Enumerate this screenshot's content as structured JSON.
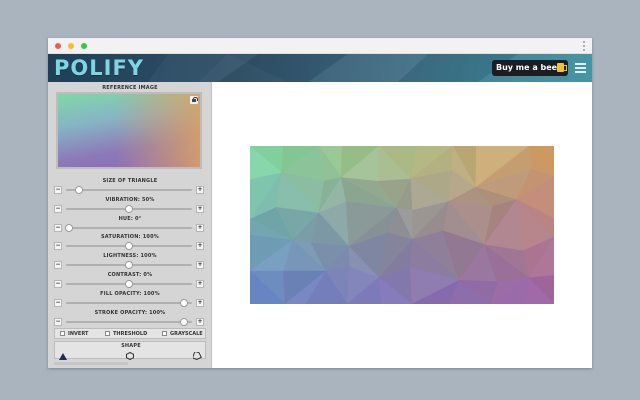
{
  "app": {
    "logo": "POLIFY",
    "buy_button": "Buy me a beer"
  },
  "icons": {
    "lock": "lock-icon",
    "menu": "hamburger-menu-icon",
    "beer": "beer-mug-icon",
    "more": "more-vertical-icon"
  },
  "sidebar": {
    "reference_label": "REFERENCE IMAGE",
    "sliders": [
      {
        "label": "SIZE OF TRIANGLE",
        "value": 0.1
      },
      {
        "label": "VIBRATION: 50%",
        "value": 0.5
      },
      {
        "label": "HUE: 0°",
        "value": 0.02
      },
      {
        "label": "SATURATION: 100%",
        "value": 0.5
      },
      {
        "label": "LIGHTNESS: 100%",
        "value": 0.5
      },
      {
        "label": "CONTRAST: 0%",
        "value": 0.5
      },
      {
        "label": "FILL OPACITY: 100%",
        "value": 0.94
      },
      {
        "label": "STROKE OPACITY: 100%",
        "value": 0.94
      }
    ],
    "minus_symbol": "−",
    "plus_symbol": "+",
    "checkboxes": [
      "INVERT",
      "THRESHOLD",
      "GRAYSCALE"
    ],
    "shape_label": "SHAPE",
    "shapes": [
      "triangle-icon",
      "hexagon-icon",
      "tag-icon"
    ]
  },
  "colors": {
    "accent": "#7fd6e3",
    "header_dark": "#1f3f57",
    "header_light": "#3b8fa0",
    "sidebar": "#d5d5d5"
  }
}
